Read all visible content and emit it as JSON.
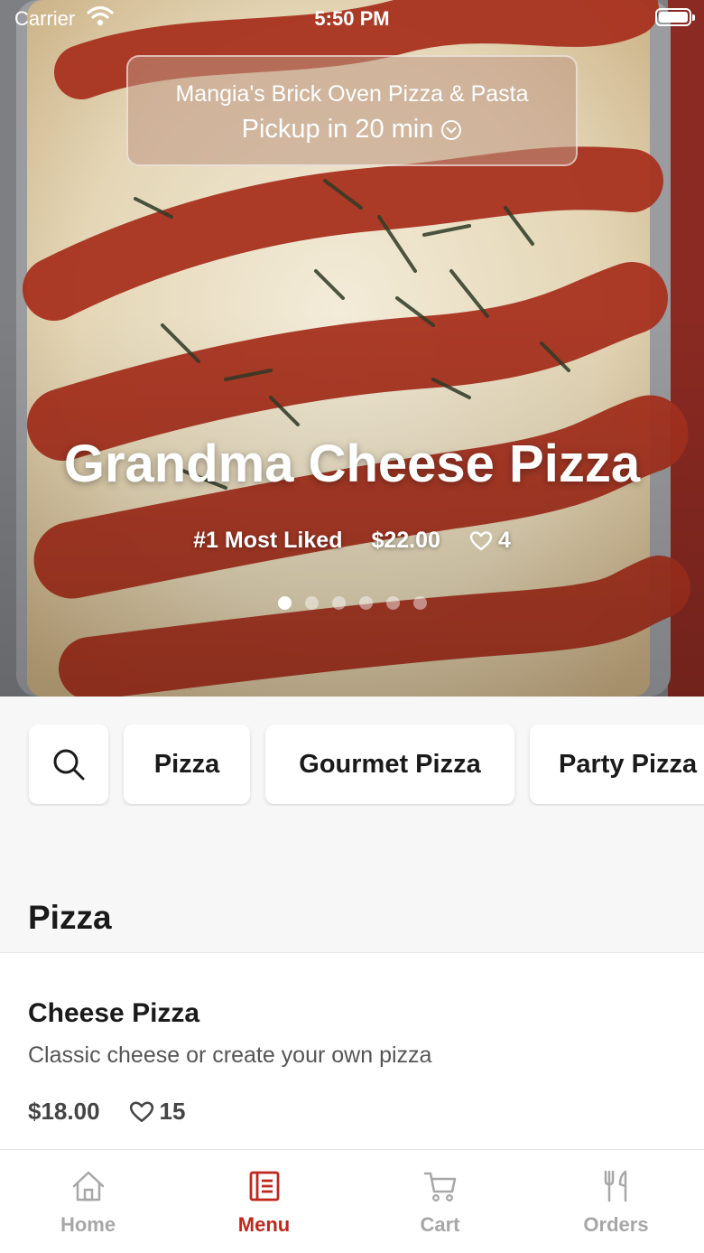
{
  "status_bar": {
    "carrier": "Carrier",
    "time": "5:50 PM"
  },
  "store": {
    "name": "Mangia's Brick Oven Pizza & Pasta",
    "pickup": "Pickup in 20 min"
  },
  "hero": {
    "title": "Grandma Cheese Pizza",
    "badge": "#1 Most Liked",
    "price": "$22.00",
    "likes": "4",
    "slide_count": 6,
    "active_slide": 1
  },
  "categories": [
    "Pizza",
    "Gourmet Pizza",
    "Party Pizza"
  ],
  "section": {
    "title": "Pizza"
  },
  "items": [
    {
      "name": "Cheese Pizza",
      "description": "Classic cheese or create your own pizza",
      "price": "$18.00",
      "likes": "15"
    }
  ],
  "tabs": [
    {
      "label": "Home",
      "icon": "home-icon",
      "active": false
    },
    {
      "label": "Menu",
      "icon": "menu-icon",
      "active": true
    },
    {
      "label": "Cart",
      "icon": "cart-icon",
      "active": false
    },
    {
      "label": "Orders",
      "icon": "utensils-icon",
      "active": false
    }
  ],
  "colors": {
    "accent": "#c0271d",
    "tab_inactive": "#a7a7a7",
    "background": "#f7f7f7"
  }
}
